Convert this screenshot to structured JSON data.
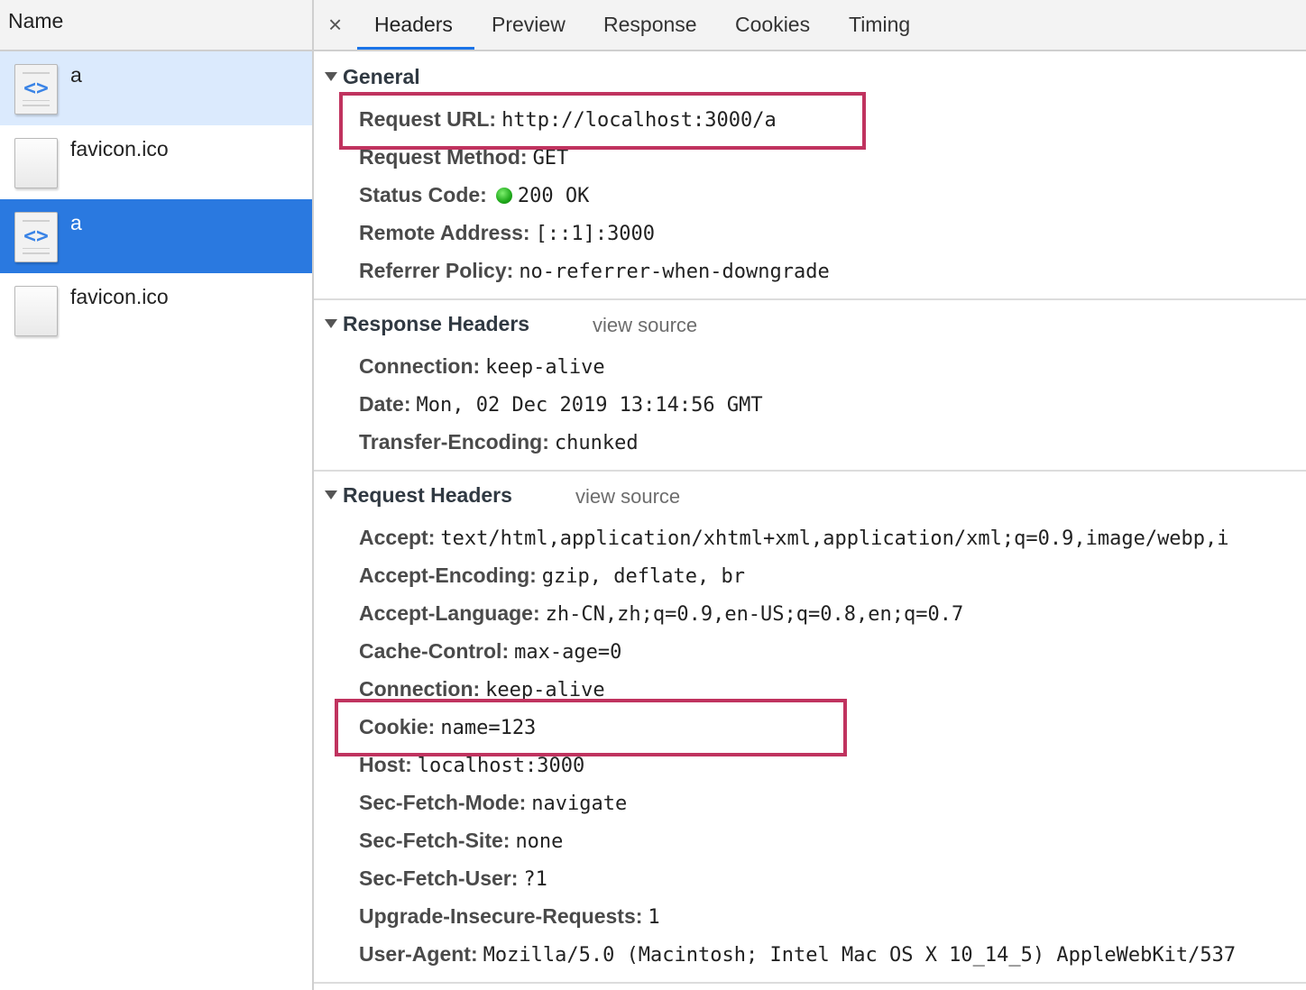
{
  "requests": {
    "header": "Name",
    "items": [
      {
        "name": "a",
        "type": "document",
        "state": "light"
      },
      {
        "name": "favicon.ico",
        "type": "file",
        "state": "none"
      },
      {
        "name": "a",
        "type": "document",
        "state": "selected"
      },
      {
        "name": "favicon.ico",
        "type": "file",
        "state": "none"
      }
    ]
  },
  "tabs": [
    "Headers",
    "Preview",
    "Response",
    "Cookies",
    "Timing"
  ],
  "active_tab": "Headers",
  "general": {
    "title": "General",
    "rows": [
      {
        "key": "Request URL:",
        "value": "http://localhost:3000/a"
      },
      {
        "key": "Request Method:",
        "value": "GET"
      },
      {
        "key": "Status Code:",
        "value": "200 OK"
      },
      {
        "key": "Remote Address:",
        "value": "[::1]:3000"
      },
      {
        "key": "Referrer Policy:",
        "value": "no-referrer-when-downgrade"
      }
    ]
  },
  "response_headers": {
    "title": "Response Headers",
    "view_source": "view source",
    "rows": [
      {
        "key": "Connection:",
        "value": "keep-alive"
      },
      {
        "key": "Date:",
        "value": "Mon, 02 Dec 2019 13:14:56 GMT"
      },
      {
        "key": "Transfer-Encoding:",
        "value": "chunked"
      }
    ]
  },
  "request_headers": {
    "title": "Request Headers",
    "view_source": "view source",
    "rows": [
      {
        "key": "Accept:",
        "value": "text/html,application/xhtml+xml,application/xml;q=0.9,image/webp,i"
      },
      {
        "key": "Accept-Encoding:",
        "value": "gzip, deflate, br"
      },
      {
        "key": "Accept-Language:",
        "value": "zh-CN,zh;q=0.9,en-US;q=0.8,en;q=0.7"
      },
      {
        "key": "Cache-Control:",
        "value": "max-age=0"
      },
      {
        "key": "Connection:",
        "value": "keep-alive"
      },
      {
        "key": "Cookie:",
        "value": "name=123"
      },
      {
        "key": "Host:",
        "value": "localhost:3000"
      },
      {
        "key": "Sec-Fetch-Mode:",
        "value": "navigate"
      },
      {
        "key": "Sec-Fetch-Site:",
        "value": "none"
      },
      {
        "key": "Sec-Fetch-User:",
        "value": "?1"
      },
      {
        "key": "Upgrade-Insecure-Requests:",
        "value": "1"
      },
      {
        "key": "User-Agent:",
        "value": "Mozilla/5.0 (Macintosh; Intel Mac OS X 10_14_5) AppleWebKit/537"
      }
    ]
  },
  "colors": {
    "selection_blue": "#2a79e0",
    "selection_light": "#dbeafd",
    "highlight_box": "#c0335f",
    "status_ok": "#1ea81a"
  }
}
